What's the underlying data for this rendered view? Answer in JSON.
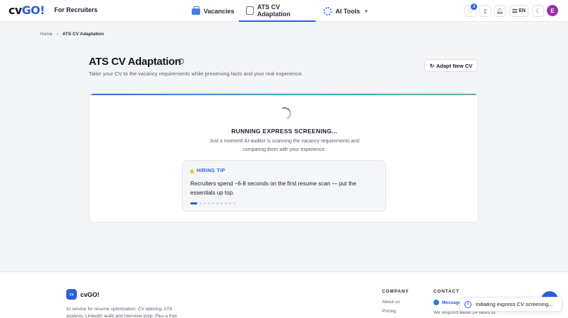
{
  "header": {
    "logo_prefix": "cv",
    "logo_suffix": "GO!",
    "for_recruiters": "For Recruiters",
    "nav": [
      {
        "label": "Vacancies",
        "icon": "briefcase-icon"
      },
      {
        "label": "ATS CV Adaptation",
        "icon": "scan-icon",
        "active": true
      },
      {
        "label": "AI Tools",
        "icon": "gear-icon"
      }
    ],
    "favorites_count": "3",
    "language": "EN",
    "avatar_initial": "E"
  },
  "breadcrumb": {
    "home": "Home",
    "separator": "›",
    "current": "ATS CV Adaptation"
  },
  "page": {
    "title": "ATS CV Adaptation",
    "help_icon": "?",
    "subtitle": "Tailor your CV to the vacancy requirements while preserving facts and your real experience.",
    "adapt_button": "Adapt New CV",
    "adapt_icon": "↻"
  },
  "screening": {
    "title": "RUNNING EXPRESS SCREENING...",
    "description": "Just a moment! AI-auditor is scanning the vacancy requirements and comparing them with your experience."
  },
  "tip": {
    "heading": "HIRING TIP",
    "text": "Recruiters spend ~6-8 seconds on the first resume scan — put the essentials up top.",
    "total_slides": 10,
    "active_slide": 1
  },
  "footer": {
    "brand_mark": "cv",
    "brand_name": "cvGO!",
    "description": "AI service for resume optimization: CV tailoring, ATS analysis, LinkedIn audit and interview prep. Plus a free",
    "company_heading": "COMPANY",
    "company_links": [
      "About us",
      "Pricing"
    ],
    "contact_heading": "CONTACT",
    "message_label": "Message",
    "respond_text": "We respond within 24 hours to"
  },
  "toast": {
    "text": "Initiating express CV screening...",
    "icon": "i"
  },
  "colors": {
    "accent": "#2b5fd9",
    "avatar": "#9b2fa8"
  }
}
